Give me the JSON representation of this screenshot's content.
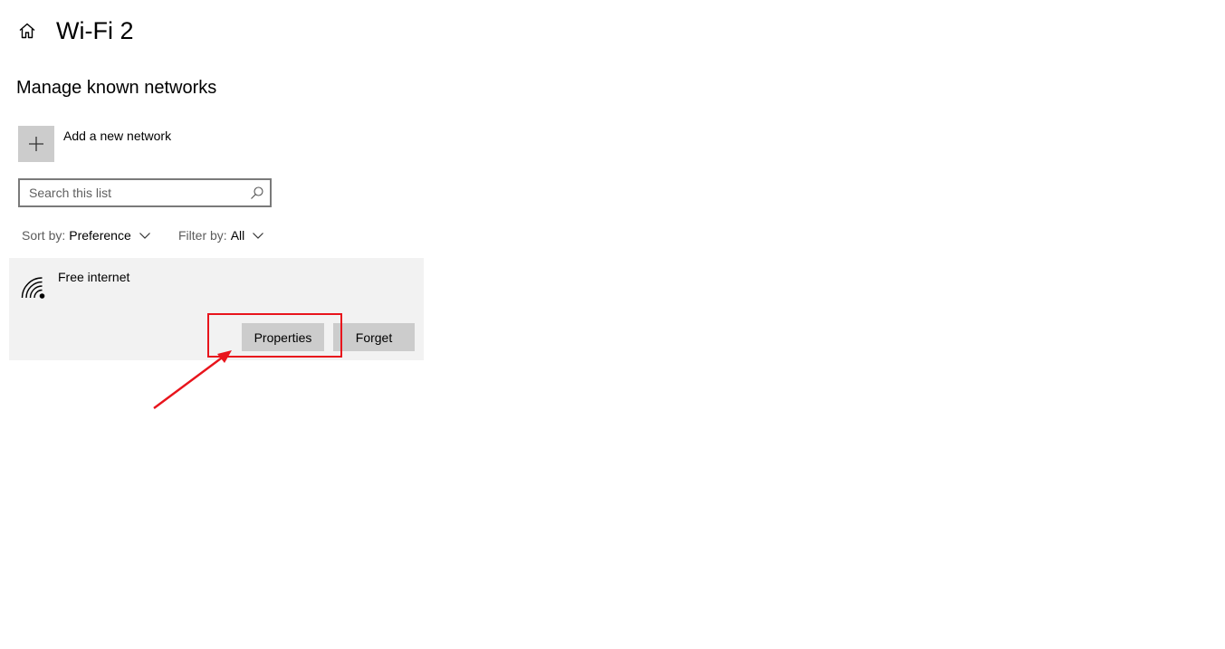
{
  "header": {
    "home_icon": "home-icon",
    "title": "Wi-Fi 2"
  },
  "section": {
    "title": "Manage known networks"
  },
  "add_network": {
    "icon": "plus-icon",
    "label": "Add a new network"
  },
  "search": {
    "placeholder": "Search this list",
    "value": "",
    "icon": "search-icon"
  },
  "sort": {
    "label": "Sort by:",
    "value": "Preference"
  },
  "filter": {
    "label": "Filter by:",
    "value": "All"
  },
  "networks": [
    {
      "name": "Free internet",
      "icon": "wifi-icon",
      "properties_label": "Properties",
      "forget_label": "Forget"
    }
  ],
  "annotation": {
    "color": "#e8141c",
    "target": "Properties"
  },
  "colors": {
    "tile_gray": "#cccccc",
    "card_bg": "#f2f2f2",
    "search_border": "#7a7a7a"
  }
}
